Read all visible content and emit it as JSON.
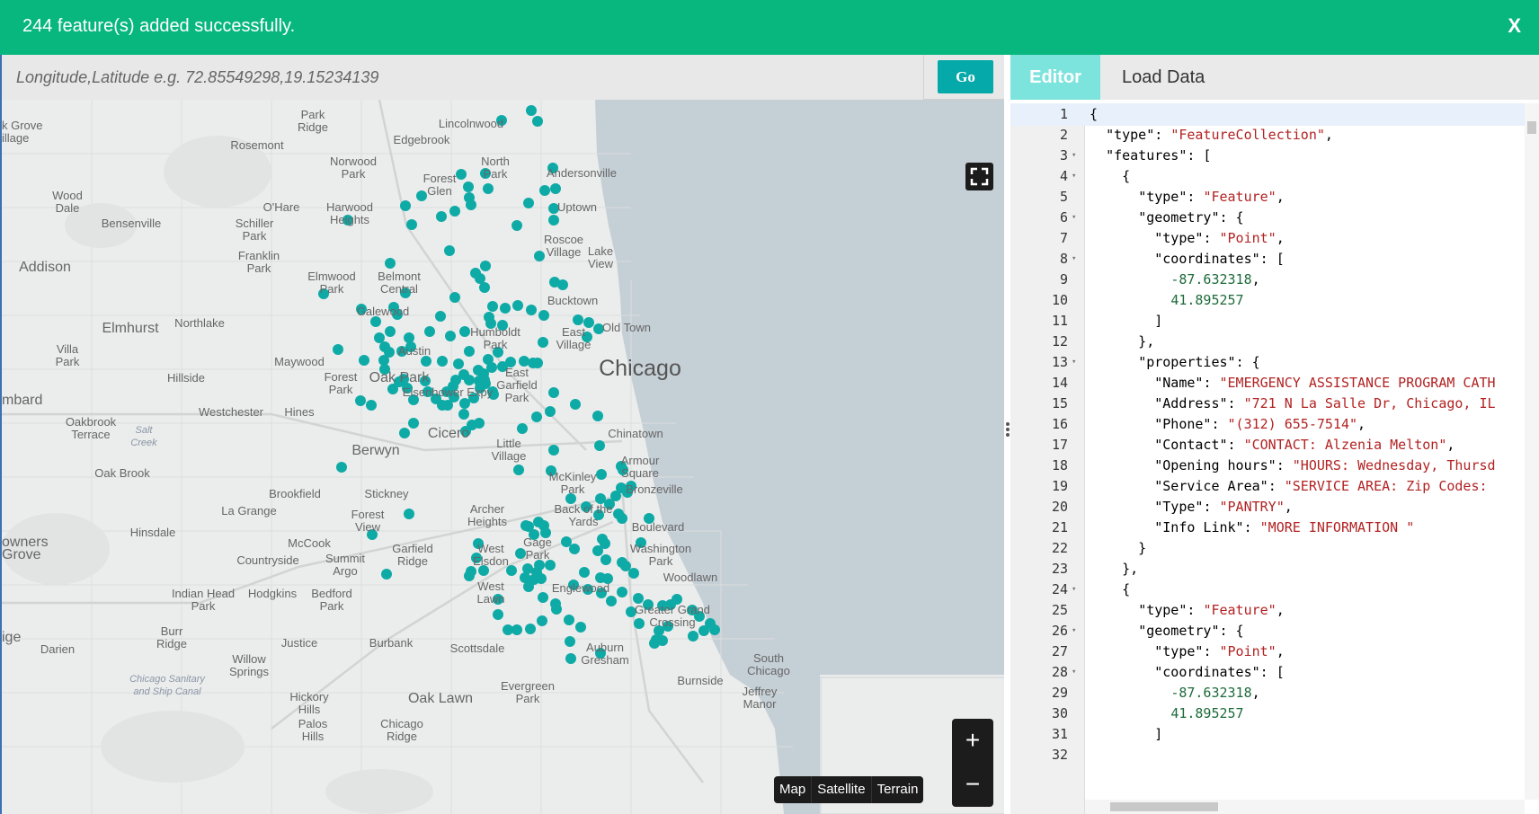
{
  "banner": {
    "message": "244 feature(s) added successfully.",
    "close_label": "X",
    "color": "#07b77e"
  },
  "search": {
    "placeholder": "Longitude,Latitude e.g. 72.85549298,19.15234139",
    "go_label": "Go"
  },
  "map": {
    "labels": {
      "city": "Chicago",
      "park_ridge": "Park\nRidge",
      "lincolnwood": "Lincolnwood",
      "elk_grove_village": "k Grove\nillage",
      "rosemont": "Rosemont",
      "edgebrook": "Edgebrook",
      "norwood_park": "Norwood\nPark",
      "north_park": "North\nPark",
      "andersonville": "Andersonville",
      "forest_glen": "Forest\nGlen",
      "wood_dale": "Wood\nDale",
      "ohare": "O'Hare",
      "harwood_heights": "Harwood\nHeights",
      "uptown": "Uptown",
      "bensenville": "Bensenville",
      "schiller_park": "Schiller\nPark",
      "roscoe_village": "Roscoe\nVillage",
      "lake_view": "Lake\nView",
      "franklin_park": "Franklin\nPark",
      "addison": "Addison",
      "elmwood_park": "Elmwood\nPark",
      "belmont_central": "Belmont\nCentral",
      "bucktown": "Bucktown",
      "galewood": "Galewood",
      "elmhurst": "Elmhurst",
      "northlake": "Northlake",
      "humboldt_park": "Humboldt\nPark",
      "east_village": "East\nVillage",
      "old_town": "Old Town",
      "villa_park": "Villa\nPark",
      "maywood": "Maywood",
      "austin": "Austin",
      "hillside": "Hillside",
      "oak_park": "Oak Park",
      "forest_park": "Forest\nPark",
      "east_garfield_park": "East\nGarfield\nPark",
      "eisenhower_expy": "Eisenhower Expy",
      "mbard": "mbard",
      "westchester": "Westchester",
      "hines": "Hines",
      "oakbrook_terrace": "Oakbrook\nTerrace",
      "salt_creek": "Salt\nCreek",
      "cicero": "Cicero",
      "chinatown": "Chinatown",
      "little_village": "Little\nVillage",
      "berwyn": "Berwyn",
      "armour_square": "Armour\nSquare",
      "oak_brook": "Oak Brook",
      "mckinley_park": "McKinley\nPark",
      "bronzeville": "Bronzeville",
      "brookfield": "Brookfield",
      "stickney": "Stickney",
      "la_grange": "La Grange",
      "archer_heights": "Archer\nHeights",
      "back_of_the_yards": "Back of the\nYards",
      "forest_view": "Forest\nView",
      "boulevard": "Boulevard",
      "hinsdale": "Hinsdale",
      "owners_grove": "owners\nGrove",
      "mccook": "McCook",
      "countryside": "Countryside",
      "summit_argo": "Summit\nArgo",
      "garfield_ridge": "Garfield\nRidge",
      "west_elsdon": "West\nElsdon",
      "gage_park": "Gage\nPark",
      "washington_park": "Washington\nPark",
      "woodlawn": "Woodlawn",
      "west_lawn": "West\nLawn",
      "englewood": "Englewood",
      "indian_head_park": "Indian Head\nPark",
      "hodgkins": "Hodgkins",
      "bedford_park": "Bedford\nPark",
      "greater_grand_crossing": "Greater Grand\nCrossing",
      "burr_ridge": "Burr\nRidge",
      "ige": "ige",
      "darien": "Darien",
      "willow_springs": "Willow\nSprings",
      "justice": "Justice",
      "burbank": "Burbank",
      "scottsdale": "Scottsdale",
      "auburn_gresham": "Auburn\nGresham",
      "south_chicago": "South\nChicago",
      "chicago_sanitary": "Chicago Sanitary\nand Ship Canal",
      "burnside": "Burnside",
      "evergreen_park": "Evergreen\nPark",
      "hickory_hills": "Hickory\nHills",
      "oak_lawn": "Oak Lawn",
      "jeffrey_manor": "Jeffrey\nManor",
      "palos_hills": "Palos\nHills",
      "chicago_ridge": "Chicago\nRidge"
    },
    "marker_color": "#0eaaa6",
    "water_color": "#c5cfd6",
    "zoom_in": "+",
    "zoom_out": "−",
    "maptypes": [
      "Map",
      "Satellite",
      "Terrain"
    ]
  },
  "editor": {
    "tabs": [
      "Editor",
      "Load Data"
    ],
    "active_tab_color": "#7de3dd",
    "lines": [
      {
        "n": "1",
        "fold": "",
        "t": "{"
      },
      {
        "n": "2",
        "fold": "",
        "t": "  \"type\": \"FeatureCollection\","
      },
      {
        "n": "3",
        "fold": "▾",
        "t": "  \"features\": ["
      },
      {
        "n": "4",
        "fold": "▾",
        "t": "    {"
      },
      {
        "n": "5",
        "fold": "",
        "t": "      \"type\": \"Feature\","
      },
      {
        "n": "6",
        "fold": "▾",
        "t": "      \"geometry\": {"
      },
      {
        "n": "7",
        "fold": "",
        "t": "        \"type\": \"Point\","
      },
      {
        "n": "8",
        "fold": "▾",
        "t": "        \"coordinates\": ["
      },
      {
        "n": "9",
        "fold": "",
        "t": "          -87.632318,"
      },
      {
        "n": "10",
        "fold": "",
        "t": "          41.895257"
      },
      {
        "n": "11",
        "fold": "",
        "t": "        ]"
      },
      {
        "n": "12",
        "fold": "",
        "t": "      },"
      },
      {
        "n": "13",
        "fold": "▾",
        "t": "      \"properties\": {"
      },
      {
        "n": "14",
        "fold": "",
        "t": "        \"Name\": \"EMERGENCY ASSISTANCE PROGRAM CATH"
      },
      {
        "n": "15",
        "fold": "",
        "t": "        \"Address\": \"721 N La Salle Dr, Chicago, IL"
      },
      {
        "n": "16",
        "fold": "",
        "t": "        \"Phone\": \"(312) 655-7514\","
      },
      {
        "n": "17",
        "fold": "",
        "t": "        \"Contact\": \"CONTACT: Alzenia Melton\","
      },
      {
        "n": "18",
        "fold": "",
        "t": "        \"Opening hours\": \"HOURS: Wednesday, Thursd"
      },
      {
        "n": "19",
        "fold": "",
        "t": "        \"Service Area\": \"SERVICE AREA: Zip Codes:"
      },
      {
        "n": "20",
        "fold": "",
        "t": "        \"Type\": \"PANTRY\","
      },
      {
        "n": "21",
        "fold": "",
        "t": "        \"Info Link\": \"MORE INFORMATION \""
      },
      {
        "n": "22",
        "fold": "",
        "t": "      }"
      },
      {
        "n": "23",
        "fold": "",
        "t": "    },"
      },
      {
        "n": "24",
        "fold": "▾",
        "t": "    {"
      },
      {
        "n": "25",
        "fold": "",
        "t": "      \"type\": \"Feature\","
      },
      {
        "n": "26",
        "fold": "▾",
        "t": "      \"geometry\": {"
      },
      {
        "n": "27",
        "fold": "",
        "t": "        \"type\": \"Point\","
      },
      {
        "n": "28",
        "fold": "▾",
        "t": "        \"coordinates\": ["
      },
      {
        "n": "29",
        "fold": "",
        "t": "          -87.632318,"
      },
      {
        "n": "30",
        "fold": "",
        "t": "          41.895257"
      },
      {
        "n": "31",
        "fold": "",
        "t": "        ]"
      },
      {
        "n": "32",
        "fold": "",
        "t": ""
      }
    ]
  }
}
